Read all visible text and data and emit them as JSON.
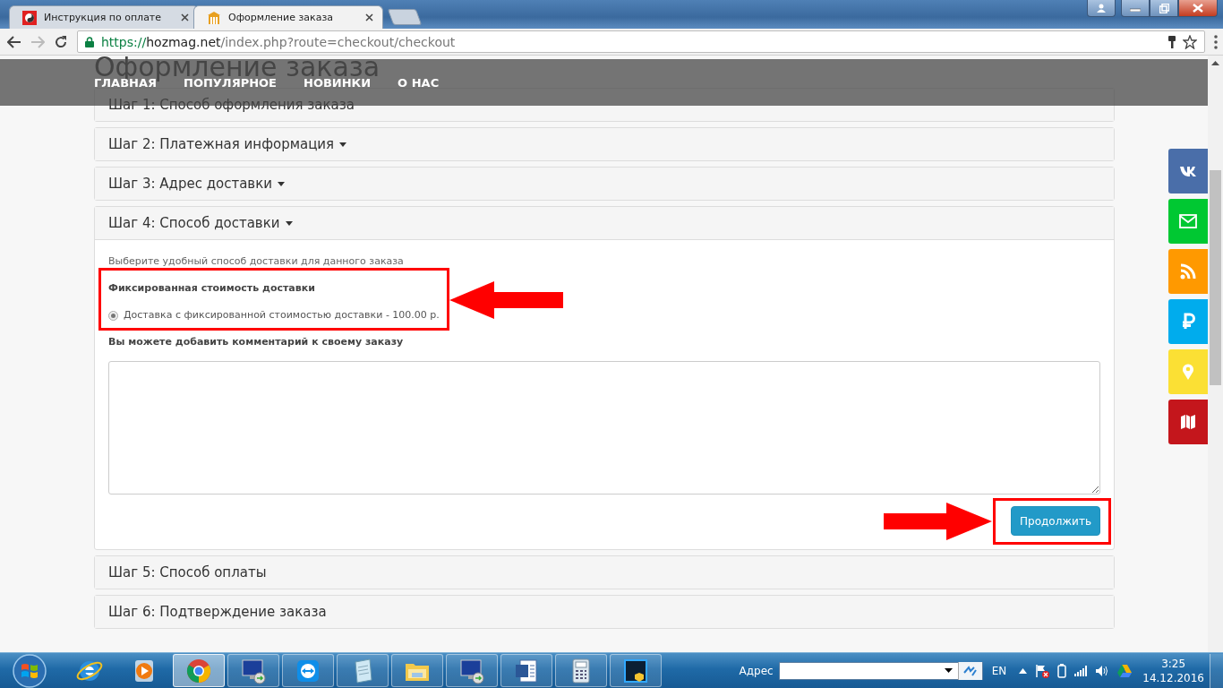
{
  "browser": {
    "tabs": [
      {
        "title": "Инструкция по оплате",
        "selected": false
      },
      {
        "title": "Оформление заказа",
        "selected": true
      }
    ],
    "url": {
      "scheme": "https://",
      "host": "hozmag.net",
      "path": "/index.php?route=checkout/checkout"
    }
  },
  "nav": {
    "items": [
      "ГЛАВНАЯ",
      "ПОПУЛЯРНОЕ",
      "НОВИНКИ",
      "О НАС"
    ]
  },
  "page": {
    "title": "Оформление заказа",
    "steps": [
      {
        "title": "Шаг 1: Способ оформления заказа",
        "link": false,
        "expanded": false
      },
      {
        "title": "Шаг 2: Платежная информация",
        "link": true,
        "expanded": false
      },
      {
        "title": "Шаг 3: Адрес доставки",
        "link": true,
        "expanded": false
      },
      {
        "title": "Шаг 4: Способ доставки",
        "link": true,
        "expanded": true
      },
      {
        "title": "Шаг 5: Способ оплаты",
        "link": false,
        "expanded": false
      },
      {
        "title": "Шаг 6: Подтверждение заказа",
        "link": false,
        "expanded": false
      }
    ],
    "delivery": {
      "intro": "Выберите удобный способ доставки для данного заказа",
      "group": "Фиксированная стоимость доставки",
      "options": [
        {
          "label": "Доставка с фиксированной стоимостью доставки - 100.00 р.",
          "selected": true
        }
      ],
      "comment_label": "Вы можете добавить комментарий к своему заказу",
      "continue": "Продолжить"
    }
  },
  "side_buttons": [
    {
      "kind": "vk",
      "color": "#4a6ea9"
    },
    {
      "kind": "mail",
      "color": "#00c832"
    },
    {
      "kind": "rss",
      "color": "#ff9900"
    },
    {
      "kind": "ruble",
      "color": "#00aced"
    },
    {
      "kind": "pin",
      "color": "#fbe034"
    },
    {
      "kind": "map",
      "color": "#c4161c"
    }
  ],
  "taskbar": {
    "apps": [
      {
        "kind": "ie",
        "running": false,
        "selected": false
      },
      {
        "kind": "media",
        "running": false,
        "selected": false
      },
      {
        "kind": "chrome",
        "running": true,
        "selected": true
      },
      {
        "kind": "remote",
        "running": true,
        "selected": false
      },
      {
        "kind": "teamviewer",
        "running": true,
        "selected": false
      },
      {
        "kind": "notepad",
        "running": true,
        "selected": false
      },
      {
        "kind": "folder",
        "running": true,
        "selected": false
      },
      {
        "kind": "remote",
        "running": true,
        "selected": false
      },
      {
        "kind": "word",
        "running": true,
        "selected": false
      },
      {
        "kind": "calculator",
        "running": true,
        "selected": false
      },
      {
        "kind": "photoshop",
        "running": true,
        "selected": false
      }
    ],
    "address_label": "Адрес",
    "language": "EN",
    "time": "3:25",
    "date": "14.12.2016"
  }
}
